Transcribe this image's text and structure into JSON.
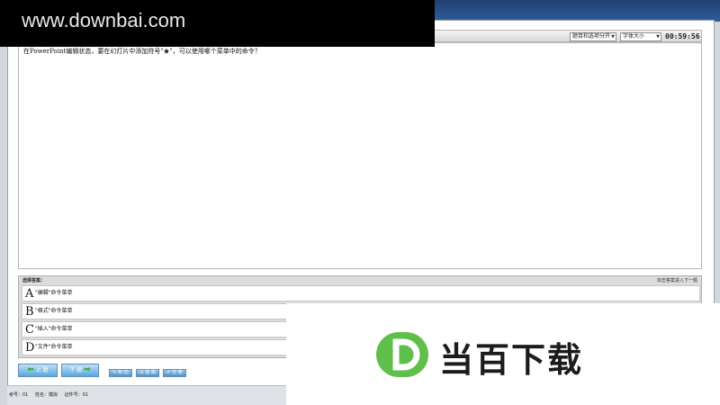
{
  "toolbar": {
    "layout_select": "题目和选项分开",
    "font_select": "字体大小",
    "timer": "00:59:56"
  },
  "question": {
    "text": "在PowerPoint编辑状态，要在幻灯片中添加符号\"★\"，可以使用哪个菜单中的命令？"
  },
  "answers": {
    "header": "选择答案：",
    "hint": "双击答案进入下一题",
    "options": [
      {
        "letter": "A",
        "text": "\"编辑\"命令菜单"
      },
      {
        "letter": "B",
        "text": "\"格式\"命令菜单"
      },
      {
        "letter": "C",
        "text": "\"插入\"命令菜单"
      },
      {
        "letter": "D",
        "text": "\"文件\"命令菜单"
      }
    ]
  },
  "buttons": {
    "prev": "上 题",
    "next": "下 题",
    "mark": "标 记",
    "calc": "选 题",
    "submit": "交 卷"
  },
  "status": {
    "exam_no": "考号：01",
    "name": "姓名：模拟",
    "id_no": "证件号：01"
  },
  "watermarks": {
    "site": "www.downbai.com",
    "logo_text": "当百下载",
    "logo_color": "#5fbf4a"
  }
}
